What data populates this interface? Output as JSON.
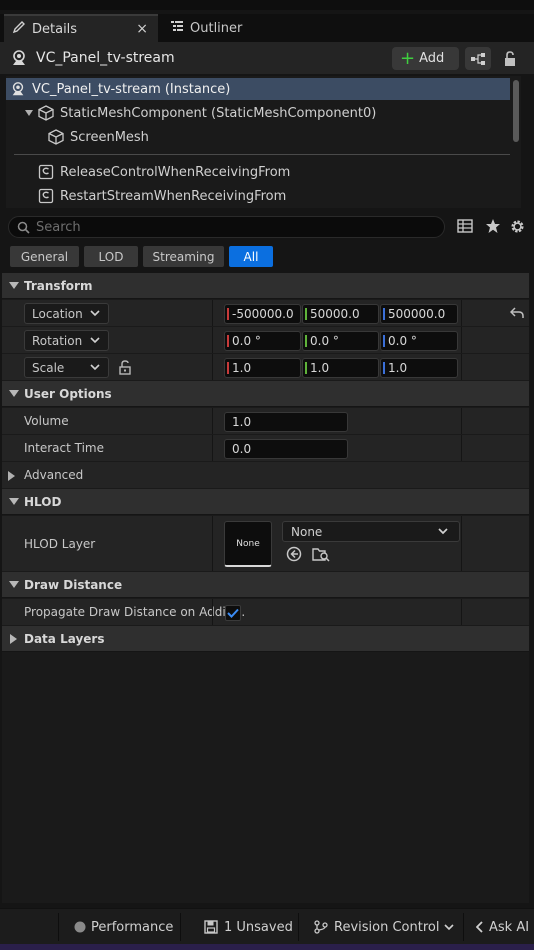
{
  "tabs": {
    "details": "Details",
    "outliner": "Outliner",
    "close": "×"
  },
  "actor": {
    "name": "VC_Panel_tv-stream",
    "add_label": "Add"
  },
  "tree": {
    "items": [
      "VC_Panel_tv-stream (Instance)",
      "StaticMeshComponent (StaticMeshComponent0)",
      "ScreenMesh",
      "ReleaseControlWhenReceivingFrom",
      "RestartStreamWhenReceivingFrom"
    ]
  },
  "search": {
    "placeholder": "Search"
  },
  "filters": [
    "General",
    "LOD",
    "Streaming",
    "All"
  ],
  "transform": {
    "title": "Transform",
    "location_label": "Location",
    "rotation_label": "Rotation",
    "scale_label": "Scale",
    "location": [
      "-500000.0",
      "50000.0",
      "500000.0"
    ],
    "rotation": [
      "0.0 °",
      "0.0 °",
      "0.0 °"
    ],
    "scale": [
      "1.0",
      "1.0",
      "1.0"
    ]
  },
  "user_options": {
    "title": "User Options",
    "volume_label": "Volume",
    "volume": "1.0",
    "interact_label": "Interact Time",
    "interact": "0.0",
    "advanced": "Advanced"
  },
  "hlod": {
    "title": "HLOD",
    "layer_label": "HLOD Layer",
    "thumb": "None",
    "value": "None"
  },
  "draw_distance": {
    "title": "Draw Distance",
    "propagate_label": "Propagate Draw Distance on Additi..."
  },
  "data_layers": {
    "title": "Data Layers"
  },
  "status": {
    "performance": "Performance",
    "unsaved": "1 Unsaved",
    "revision": "Revision Control",
    "ask": "Ask AI"
  },
  "colors": {
    "accent": "#0b6fe0",
    "axis_x": "#c83a3a",
    "axis_y": "#5fb33a",
    "axis_z": "#3a6fd8",
    "selection": "#3c4c63"
  }
}
